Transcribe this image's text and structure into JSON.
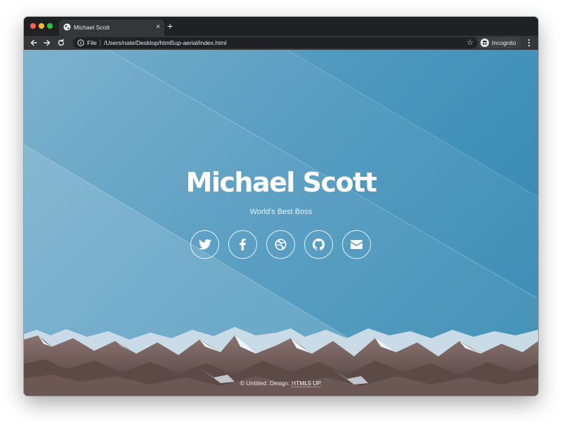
{
  "browser": {
    "tab": {
      "title": "Michael Scott",
      "close_glyph": "×",
      "favicon": "globe-icon"
    },
    "new_tab_glyph": "+",
    "omnibox": {
      "scheme_label": "File",
      "url": "/Users/nate/Desktop/html5up-aerial/index.html",
      "star_glyph": "☆"
    },
    "profile": {
      "label": "Incognito"
    },
    "colors": {
      "frame": "#202124",
      "toolbar": "#35363a",
      "traffic_red": "#ff5f57",
      "traffic_yellow": "#febc2e",
      "traffic_green": "#28c840"
    }
  },
  "page": {
    "title": "Michael Scott",
    "subtitle": "World's Best Boss",
    "social": [
      {
        "icon": "twitter-icon"
      },
      {
        "icon": "facebook-icon"
      },
      {
        "icon": "dribbble-icon"
      },
      {
        "icon": "github-icon"
      },
      {
        "icon": "envelope-icon"
      }
    ],
    "footer": {
      "prefix": "© Untitled. Design: ",
      "link_text": "HTML5 UP",
      "suffix": "."
    },
    "colors": {
      "background": "#2f86b0",
      "text": "#ffffff"
    }
  }
}
